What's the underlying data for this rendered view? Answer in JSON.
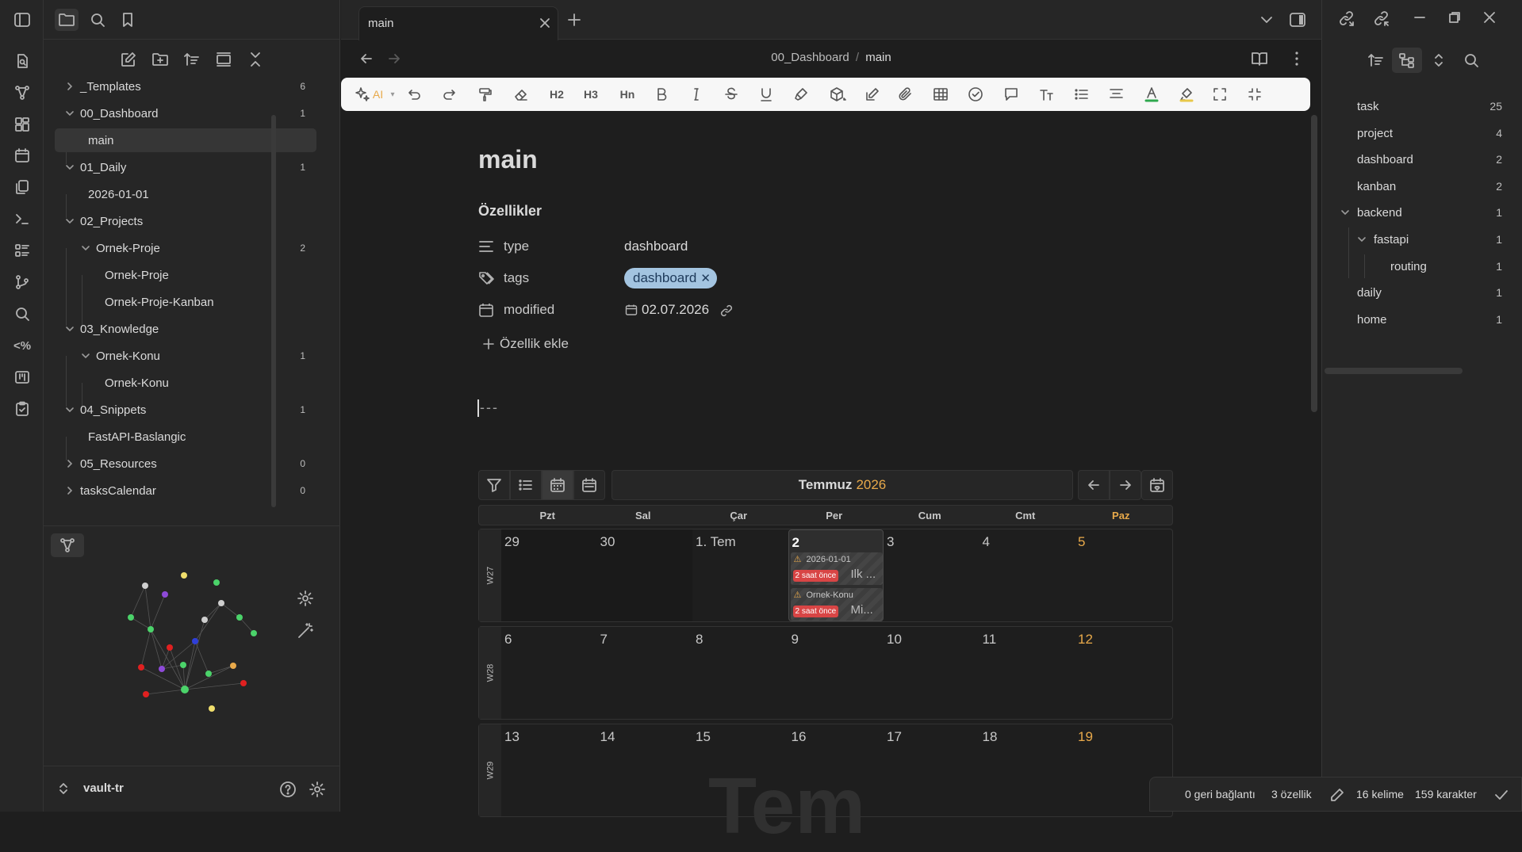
{
  "ribbon": {
    "icons": [
      "sidebar-toggle-icon",
      "quick-switcher-icon",
      "graph-view-icon",
      "canvas-icon",
      "daily-note-icon",
      "templates-icon",
      "command-palette-icon",
      "outline-icon",
      "git-icon",
      "search-icon",
      "code-snippet-icon",
      "kanban-icon",
      "tasks-icon"
    ],
    "code_label": "<%"
  },
  "left_sidebar": {
    "tree": [
      {
        "label": "_Templates",
        "count": "6"
      },
      {
        "label": "00_Dashboard",
        "count": "1"
      },
      {
        "label": "main",
        "count": ""
      },
      {
        "label": "01_Daily",
        "count": "1"
      },
      {
        "label": "2026-01-01",
        "count": ""
      },
      {
        "label": "02_Projects",
        "count": ""
      },
      {
        "label": "Ornek-Proje",
        "count": "2"
      },
      {
        "label": "Ornek-Proje",
        "count": ""
      },
      {
        "label": "Ornek-Proje-Kanban",
        "count": ""
      },
      {
        "label": "03_Knowledge",
        "count": ""
      },
      {
        "label": "Ornek-Konu",
        "count": "1"
      },
      {
        "label": "Ornek-Konu",
        "count": ""
      },
      {
        "label": "04_Snippets",
        "count": "1"
      },
      {
        "label": "FastAPI-Baslangic",
        "count": ""
      },
      {
        "label": "05_Resources",
        "count": "0"
      },
      {
        "label": "tasksCalendar",
        "count": "0"
      }
    ],
    "vault_name": "vault-tr"
  },
  "tabs": [
    {
      "label": "main"
    }
  ],
  "breadcrumb": {
    "folder": "00_Dashboard",
    "separator": "/",
    "file": "main"
  },
  "toolbar": {
    "ai_label": "AI",
    "h2": "H2",
    "h3": "H3",
    "hn": "Hn"
  },
  "note": {
    "title": "main",
    "properties_heading": "Özellikler",
    "properties": [
      {
        "key": "type",
        "value": "dashboard"
      },
      {
        "key": "tags",
        "value": "dashboard"
      },
      {
        "key": "modified",
        "value": "02.07.2026"
      }
    ],
    "add_property": "Özellik ekle",
    "divider_text": "---"
  },
  "calendar": {
    "month": "Temmuz",
    "year": "2026",
    "weekdays": [
      "Pzt",
      "Sal",
      "Çar",
      "Per",
      "Cum",
      "Cmt",
      "Paz"
    ],
    "weeks": [
      {
        "label": "W27",
        "days": [
          "29",
          "30",
          "1. Tem",
          "2",
          "3",
          "4",
          "5"
        ]
      },
      {
        "label": "W28",
        "days": [
          "6",
          "7",
          "8",
          "9",
          "10",
          "11",
          "12"
        ]
      },
      {
        "label": "W29",
        "days": [
          "13",
          "14",
          "15",
          "16",
          "17",
          "18",
          "19"
        ]
      }
    ],
    "events": [
      {
        "file": "2026-01-01",
        "badge": "2 saat önce",
        "text": "Ilk ..."
      },
      {
        "file": "Ornek-Konu",
        "badge": "2 saat önce",
        "text": "Mi..."
      }
    ],
    "watermark": "Tem",
    "accent": "#e8a94a"
  },
  "tags_pane": [
    {
      "label": "task",
      "count": "25"
    },
    {
      "label": "project",
      "count": "4"
    },
    {
      "label": "dashboard",
      "count": "2"
    },
    {
      "label": "kanban",
      "count": "2"
    },
    {
      "label": "backend",
      "count": "1"
    },
    {
      "label": "fastapi",
      "count": "1"
    },
    {
      "label": "routing",
      "count": "1"
    },
    {
      "label": "daily",
      "count": "1"
    },
    {
      "label": "home",
      "count": "1"
    }
  ],
  "status_bar": {
    "backlinks": "0 geri bağlantı",
    "properties": "3 özellik",
    "words": "16 kelime",
    "chars": "159 karakter"
  }
}
